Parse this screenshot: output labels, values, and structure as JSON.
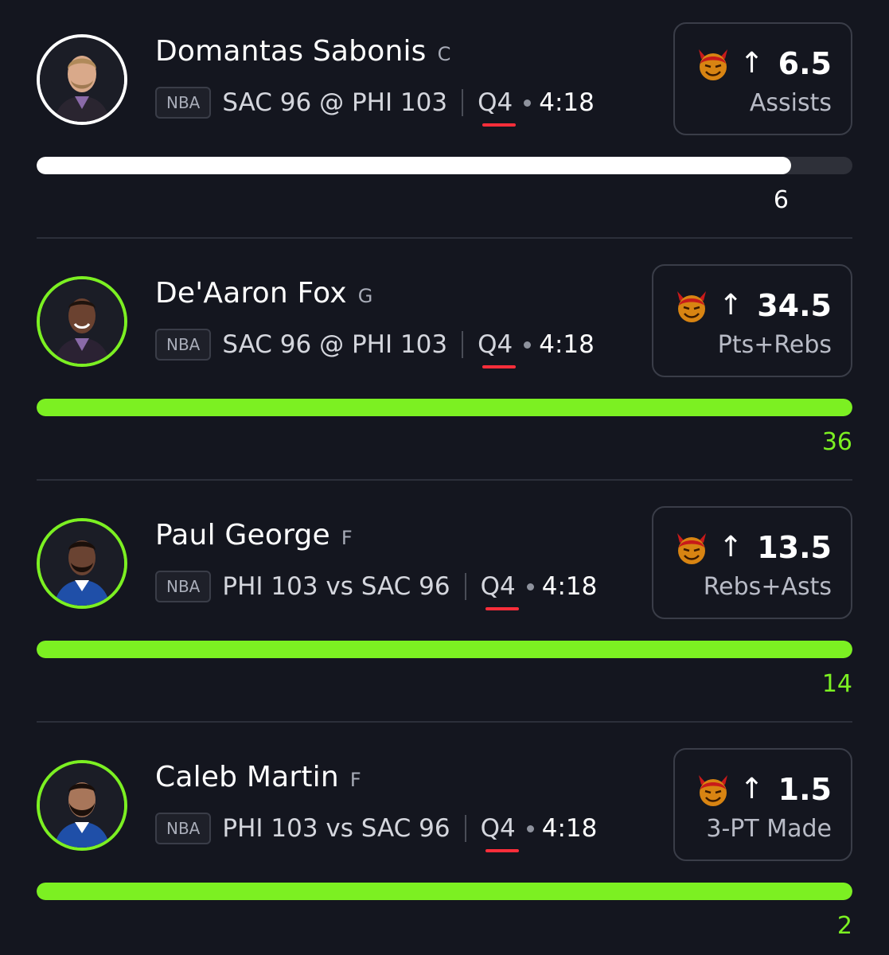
{
  "colors": {
    "background": "#14161f",
    "hit_green": "#7cf022",
    "neutral_white": "#ffffff",
    "quarter_underline": "#ff2e3a"
  },
  "picks": [
    {
      "name": "Domantas Sabonis",
      "position": "C",
      "league": "NBA",
      "matchup": "SAC 96 @ PHI 103",
      "quarter": "Q4",
      "clock": "4:18",
      "direction_icon": "arrow-up-icon",
      "arrow": "↑",
      "line": "6.5",
      "stat": "Assists",
      "actual": "6",
      "progress": 0.925,
      "status": "neutral"
    },
    {
      "name": "De'Aaron Fox",
      "position": "G",
      "league": "NBA",
      "matchup": "SAC 96 @ PHI 103",
      "quarter": "Q4",
      "clock": "4:18",
      "direction_icon": "arrow-up-icon",
      "arrow": "↑",
      "line": "34.5",
      "stat": "Pts+Rebs",
      "actual": "36",
      "progress": 1.0,
      "status": "hit"
    },
    {
      "name": "Paul George",
      "position": "F",
      "league": "NBA",
      "matchup": "PHI 103 vs SAC 96",
      "quarter": "Q4",
      "clock": "4:18",
      "direction_icon": "arrow-up-icon",
      "arrow": "↑",
      "line": "13.5",
      "stat": "Rebs+Asts",
      "actual": "14",
      "progress": 1.0,
      "status": "hit"
    },
    {
      "name": "Caleb Martin",
      "position": "F",
      "league": "NBA",
      "matchup": "PHI 103 vs SAC 96",
      "quarter": "Q4",
      "clock": "4:18",
      "direction_icon": "arrow-up-icon",
      "arrow": "↑",
      "line": "1.5",
      "stat": "3-PT Made",
      "actual": "2",
      "progress": 1.0,
      "status": "hit"
    }
  ]
}
